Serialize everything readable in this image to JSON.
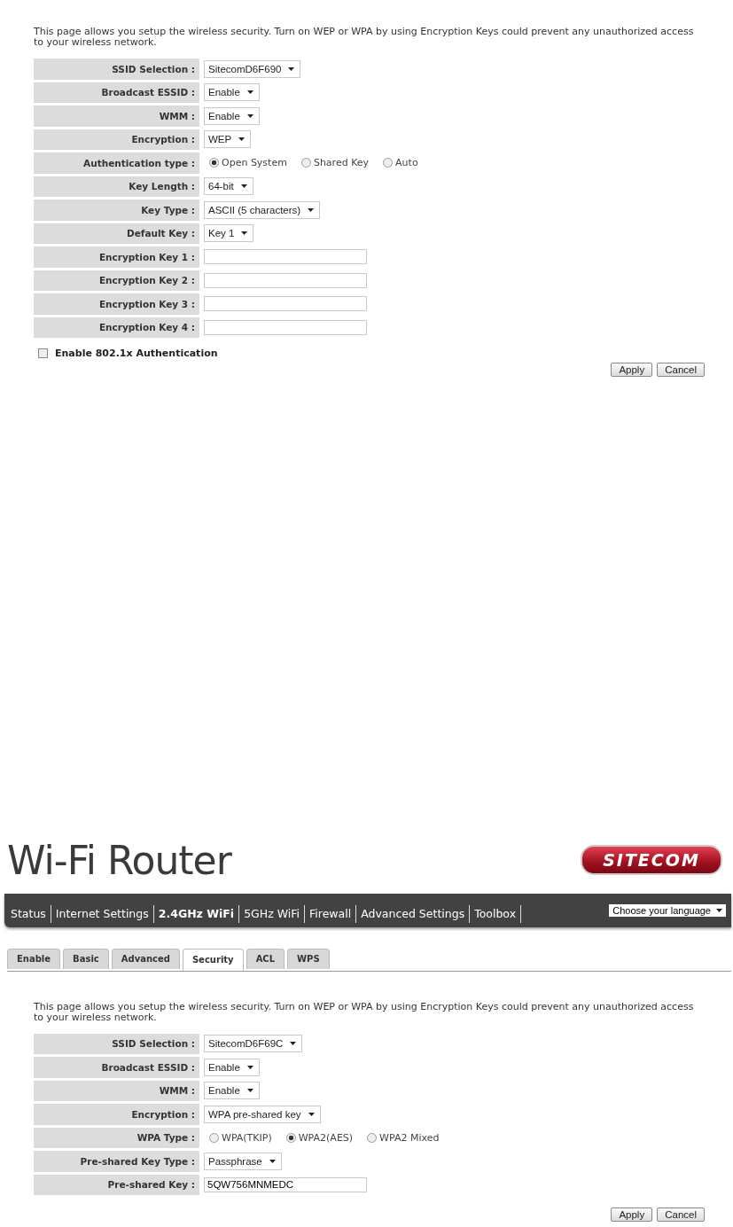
{
  "panels": [
    {
      "intro": "This page allows you setup the wireless security. Turn on WEP or WPA by using Encryption Keys could prevent any unauthorized access to your wireless network.",
      "rows": [
        {
          "label": "SSID Selection :",
          "kind": "select",
          "value": "SitecomD6F690"
        },
        {
          "label": "Broadcast ESSID :",
          "kind": "select",
          "value": "Enable"
        },
        {
          "label": "WMM :",
          "kind": "select",
          "value": "Enable"
        },
        {
          "label": "Encryption :",
          "kind": "select",
          "value": "WEP"
        },
        {
          "label": "Authentication type :",
          "kind": "radio",
          "options": [
            {
              "label": "Open System",
              "selected": true
            },
            {
              "label": "Shared Key",
              "selected": false
            },
            {
              "label": "Auto",
              "selected": false
            }
          ]
        },
        {
          "label": "Key Length :",
          "kind": "select",
          "value": "64-bit"
        },
        {
          "label": "Key Type :",
          "kind": "select",
          "value": "ASCII (5 characters)"
        },
        {
          "label": "Default Key :",
          "kind": "select",
          "value": "Key 1"
        },
        {
          "label": "Encryption Key 1 :",
          "kind": "text"
        },
        {
          "label": "Encryption Key 2 :",
          "kind": "text"
        },
        {
          "label": "Encryption Key 3 :",
          "kind": "text"
        },
        {
          "label": "Encryption Key 4 :",
          "kind": "text"
        }
      ],
      "checkbox": {
        "label": "Enable 802.1x Authentication",
        "checked": false
      },
      "buttons": [
        "Apply",
        "Cancel"
      ]
    },
    {
      "header": {
        "title": "Wi-Fi Router",
        "logo": "SITECOM",
        "nav": [
          {
            "label": "Status",
            "selected": false
          },
          {
            "label": "Internet Settings",
            "selected": false
          },
          {
            "label": "2.4GHz WiFi",
            "selected": true
          },
          {
            "label": "5GHz WiFi",
            "selected": false
          },
          {
            "label": "Firewall",
            "selected": false
          },
          {
            "label": "Advanced Settings",
            "selected": false
          },
          {
            "label": "Toolbox",
            "selected": false
          }
        ],
        "language": "Choose your language",
        "tabs": [
          {
            "label": "Enable",
            "selected": false
          },
          {
            "label": "Basic",
            "selected": false
          },
          {
            "label": "Advanced",
            "selected": false
          },
          {
            "label": "Security",
            "selected": true
          },
          {
            "label": "ACL",
            "selected": false
          },
          {
            "label": "WPS",
            "selected": false
          }
        ]
      },
      "intro": "This page allows you setup the wireless security. Turn on WEP or WPA by using Encryption Keys could prevent any unauthorized access to your wireless network.",
      "rows": [
        {
          "label": "SSID Selection :",
          "kind": "select",
          "value": "SitecomD6F69C"
        },
        {
          "label": "Broadcast ESSID :",
          "kind": "select",
          "value": "Enable"
        },
        {
          "label": "WMM :",
          "kind": "select",
          "value": "Enable"
        },
        {
          "label": "Encryption :",
          "kind": "select",
          "value": "WPA pre-shared key"
        },
        {
          "label": "WPA Type :",
          "kind": "radio",
          "options": [
            {
              "label": "WPA(TKIP)",
              "selected": false
            },
            {
              "label": "WPA2(AES)",
              "selected": true
            },
            {
              "label": "WPA2 Mixed",
              "selected": false
            }
          ]
        },
        {
          "label": "Pre-shared Key Type :",
          "kind": "select",
          "value": "Passphrase"
        },
        {
          "label": "Pre-shared Key :",
          "kind": "text",
          "value": "5QW756MNMEDC"
        }
      ],
      "buttons": [
        "Apply",
        "Cancel"
      ]
    }
  ]
}
